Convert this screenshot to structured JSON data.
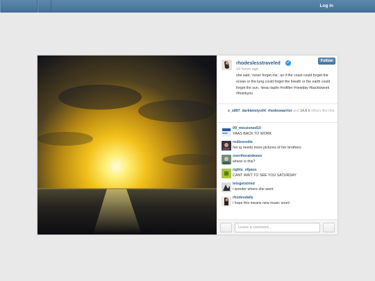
{
  "header": {
    "login_label": "Log in"
  },
  "post": {
    "username": "rhodeslesstraveled",
    "verified_icon": "verified-badge-icon",
    "time": "10 hours ago",
    "follow_label": "Follow",
    "caption": "she said, 'never forget.me,' as if the coast could forget the ocean or the lung could forget the breath or the earth could forget the sun. -beau taplin #nofilter #newday #backtowork #thankyou",
    "likes": {
      "user1": "x_o897",
      "user2": "darktwistyx04",
      "user3": "rhodeswarrior",
      "and_label": "and",
      "count": "14.8 k",
      "suffix": "others like this."
    }
  },
  "comments": [
    {
      "user": "09_missioned10",
      "text": "YAAS BACK TO WORK"
    },
    {
      "user": "rodiesrodie",
      "text": "her ig needs more pictures of her brothers"
    },
    {
      "user": "overtherainbows",
      "text": "where is this?"
    },
    {
      "user": "rights_ofpass",
      "text": "CANT WAIT TO SEE YOU SATURDAY"
    },
    {
      "user": "letsgetstrted",
      "text": "i wonder where she went"
    },
    {
      "user": "rhodesdaily",
      "text": "i hope this means new music soon!"
    }
  ],
  "footer": {
    "comment_placeholder": "Leave a comment..."
  },
  "colors": {
    "accent": "#2b5c8a",
    "topbar": "#4f7ca4",
    "follow": "#5a86ae",
    "verified": "#3897f0"
  }
}
